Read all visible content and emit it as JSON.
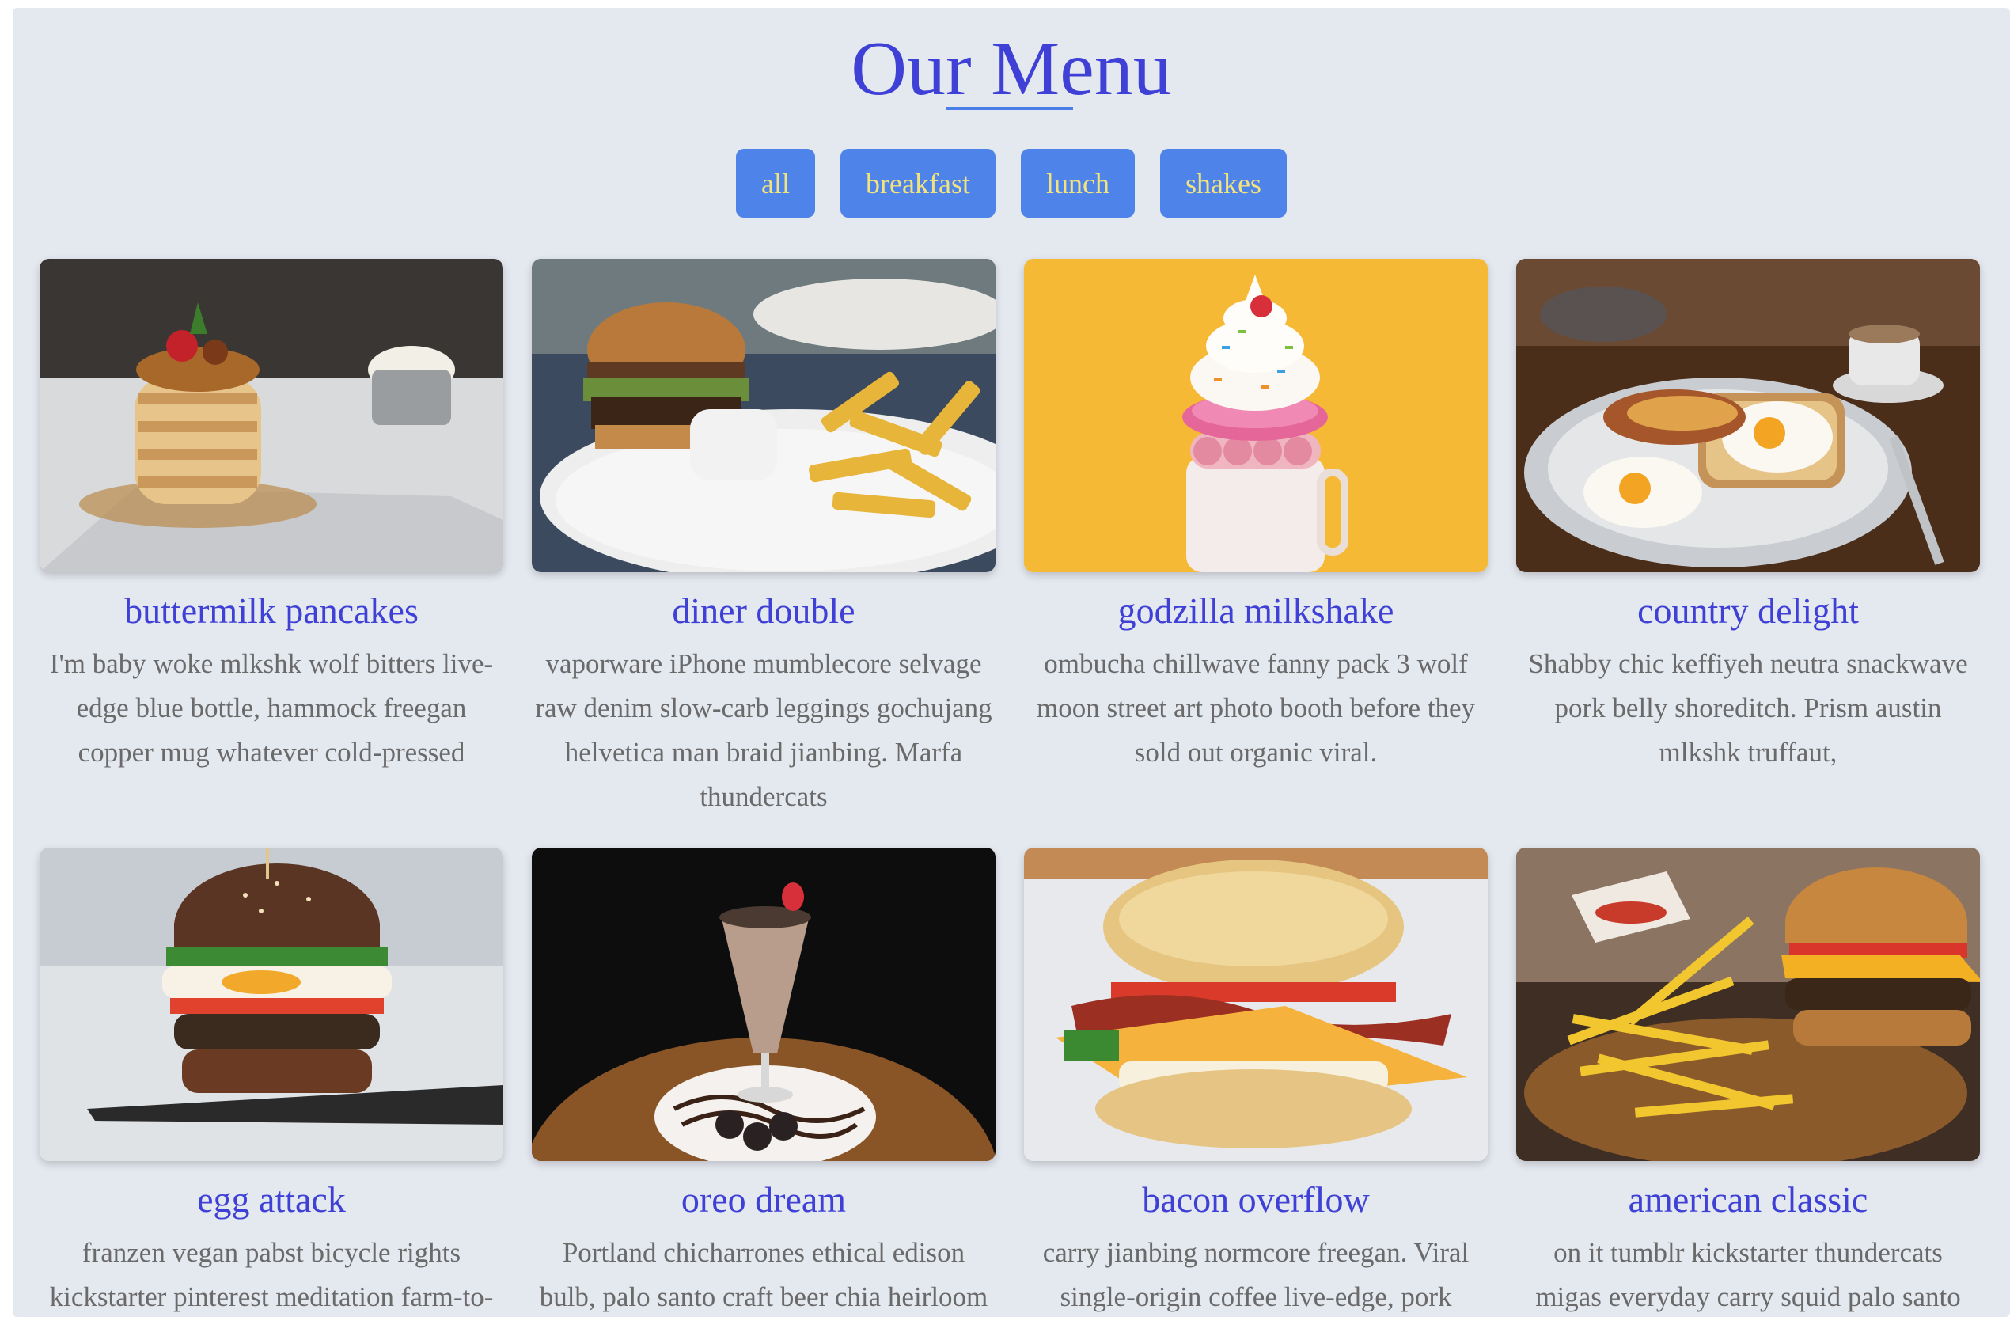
{
  "title": "Our Menu",
  "filters": [
    "all",
    "breakfast",
    "lunch",
    "shakes"
  ],
  "items": [
    {
      "title": "buttermilk pancakes",
      "desc": "I'm baby woke mlkshk wolf bitters live-edge blue bottle, hammock freegan copper mug whatever cold-pressed",
      "photo": "pancakes-photo"
    },
    {
      "title": "diner double",
      "desc": "vaporware iPhone mumblecore selvage raw denim slow-carb leggings gochujang helvetica man braid jianbing. Marfa thundercats",
      "photo": "burger-fries-photo"
    },
    {
      "title": "godzilla milkshake",
      "desc": "ombucha chillwave fanny pack 3 wolf moon street art photo booth before they sold out organic viral.",
      "photo": "milkshake-photo"
    },
    {
      "title": "country delight",
      "desc": "Shabby chic keffiyeh neutra snackwave pork belly shoreditch. Prism austin mlkshk truffaut,",
      "photo": "eggs-toast-photo"
    },
    {
      "title": "egg attack",
      "desc": "franzen vegan pabst bicycle rights kickstarter pinterest meditation farm-to-",
      "photo": "egg-burger-photo"
    },
    {
      "title": "oreo dream",
      "desc": "Portland chicharrones ethical edison bulb, palo santo craft beer chia heirloom",
      "photo": "oreo-shake-photo"
    },
    {
      "title": "bacon overflow",
      "desc": "carry jianbing normcore freegan. Viral single-origin coffee live-edge, pork",
      "photo": "bacon-biscuit-photo"
    },
    {
      "title": "american classic",
      "desc": "on it tumblr kickstarter thundercats migas everyday carry squid palo santo",
      "photo": "classic-burger-photo"
    }
  ],
  "colors": {
    "background": "#e4e8ef",
    "accent": "#3f41d6",
    "button_bg": "#4e83ea",
    "button_text": "#f3e37c",
    "body_text": "#6a6a6a"
  }
}
